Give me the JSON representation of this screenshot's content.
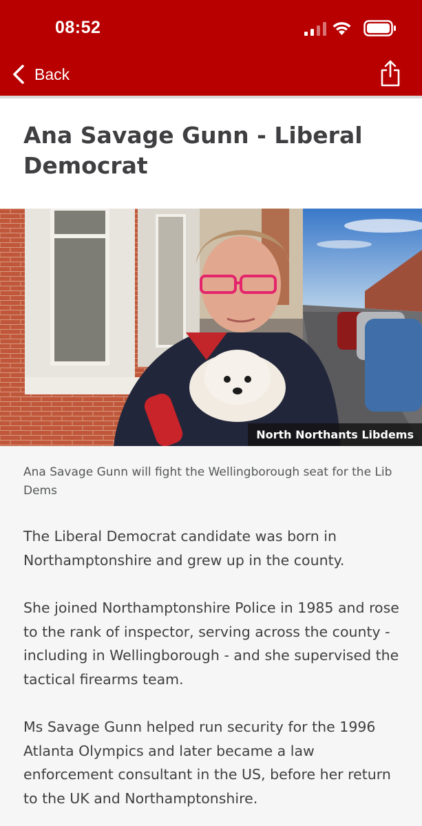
{
  "status_bar": {
    "time": "08:52"
  },
  "nav": {
    "back_label": "Back",
    "share_icon": "share-icon"
  },
  "article": {
    "headline": "Ana Savage Gunn - Liberal Democrat",
    "image": {
      "credit": "North Northants Libdems"
    },
    "caption": "Ana Savage Gunn will fight the Wellingborough seat for the Lib Dems",
    "paragraphs": [
      "The Liberal Democrat candidate was born in Northamptonshire and grew up in the county.",
      "She joined Northamptonshire Police in 1985 and rose to the rank of inspector, serving across the county - including in Wellingborough - and she supervised the tactical firearms team.",
      "Ms Savage Gunn helped run security for the 1996 Atlanta Olympics and later became a law enforcement consultant in the US, before her return to the UK and Northamptonshire."
    ]
  },
  "colors": {
    "brand_red": "#b80000",
    "background": "#f6f6f6",
    "text": "#3f3f42"
  }
}
